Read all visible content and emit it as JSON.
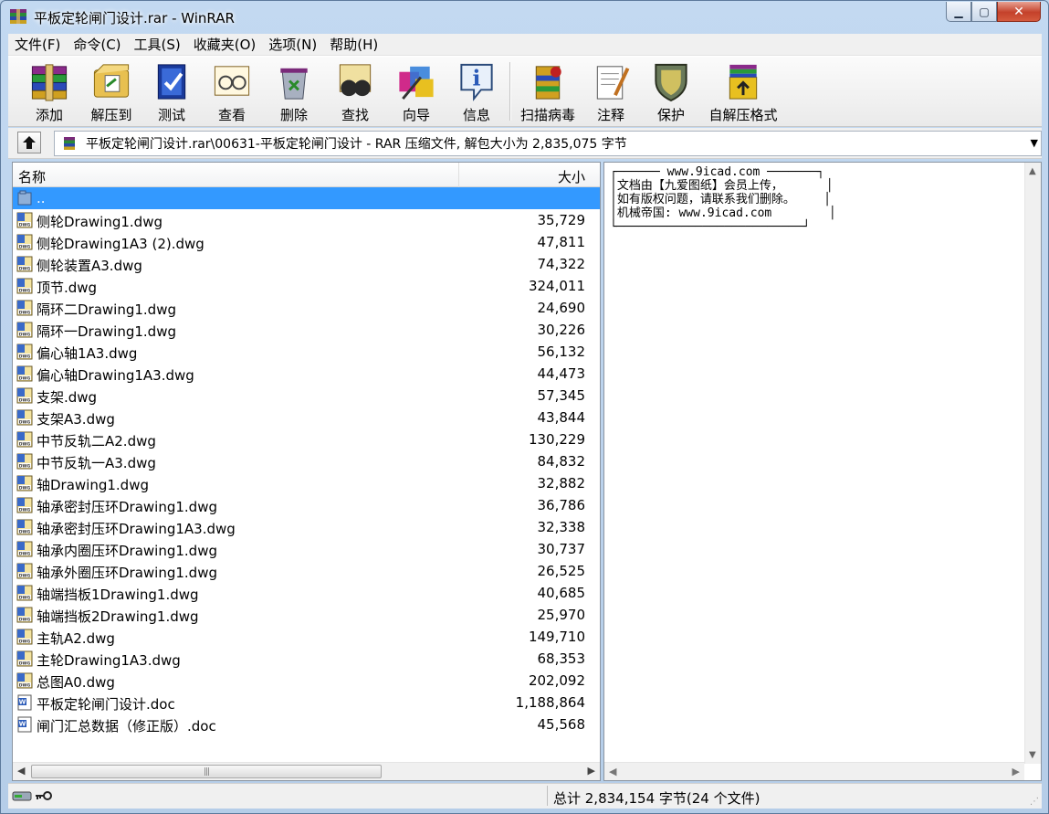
{
  "window": {
    "title": "平板定轮闸门设计.rar - WinRAR"
  },
  "menu": [
    "文件(F)",
    "命令(C)",
    "工具(S)",
    "收藏夹(O)",
    "选项(N)",
    "帮助(H)"
  ],
  "toolbar": [
    {
      "label": "添加",
      "icon": "add-archive-icon"
    },
    {
      "label": "解压到",
      "icon": "extract-to-icon"
    },
    {
      "label": "测试",
      "icon": "test-icon"
    },
    {
      "label": "查看",
      "icon": "view-icon"
    },
    {
      "label": "删除",
      "icon": "delete-icon"
    },
    {
      "label": "查找",
      "icon": "find-icon"
    },
    {
      "label": "向导",
      "icon": "wizard-icon"
    },
    {
      "label": "信息",
      "icon": "info-icon"
    },
    {
      "label": "扫描病毒",
      "icon": "scan-virus-icon"
    },
    {
      "label": "注释",
      "icon": "comment-icon"
    },
    {
      "label": "保护",
      "icon": "protect-icon"
    },
    {
      "label": "自解压格式",
      "icon": "sfx-icon"
    }
  ],
  "address": {
    "path": "平板定轮闸门设计.rar\\00631-平板定轮闸门设计 - RAR 压缩文件, 解包大小为 2,835,075 字节"
  },
  "list": {
    "col_name": "名称",
    "col_size": "大小",
    "rows": [
      {
        "name": "..",
        "size": "",
        "type": "folder-up",
        "selected": true
      },
      {
        "name": "侧轮Drawing1.dwg",
        "size": "35,729",
        "type": "dwg"
      },
      {
        "name": "侧轮Drawing1A3 (2).dwg",
        "size": "47,811",
        "type": "dwg"
      },
      {
        "name": "侧轮装置A3.dwg",
        "size": "74,322",
        "type": "dwg"
      },
      {
        "name": "顶节.dwg",
        "size": "324,011",
        "type": "dwg"
      },
      {
        "name": "隔环二Drawing1.dwg",
        "size": "24,690",
        "type": "dwg"
      },
      {
        "name": "隔环一Drawing1.dwg",
        "size": "30,226",
        "type": "dwg"
      },
      {
        "name": "偏心轴1A3.dwg",
        "size": "56,132",
        "type": "dwg"
      },
      {
        "name": "偏心轴Drawing1A3.dwg",
        "size": "44,473",
        "type": "dwg"
      },
      {
        "name": "支架.dwg",
        "size": "57,345",
        "type": "dwg"
      },
      {
        "name": "支架A3.dwg",
        "size": "43,844",
        "type": "dwg"
      },
      {
        "name": "中节反轨二A2.dwg",
        "size": "130,229",
        "type": "dwg"
      },
      {
        "name": "中节反轨一A3.dwg",
        "size": "84,832",
        "type": "dwg"
      },
      {
        "name": "轴Drawing1.dwg",
        "size": "32,882",
        "type": "dwg"
      },
      {
        "name": "轴承密封压环Drawing1.dwg",
        "size": "36,786",
        "type": "dwg"
      },
      {
        "name": "轴承密封压环Drawing1A3.dwg",
        "size": "32,338",
        "type": "dwg"
      },
      {
        "name": "轴承内圈压环Drawing1.dwg",
        "size": "30,737",
        "type": "dwg"
      },
      {
        "name": "轴承外圈压环Drawing1.dwg",
        "size": "26,525",
        "type": "dwg"
      },
      {
        "name": "轴端挡板1Drawing1.dwg",
        "size": "40,685",
        "type": "dwg"
      },
      {
        "name": "轴端挡板2Drawing1.dwg",
        "size": "25,970",
        "type": "dwg"
      },
      {
        "name": "主轨A2.dwg",
        "size": "149,710",
        "type": "dwg"
      },
      {
        "name": "主轮Drawing1A3.dwg",
        "size": "68,353",
        "type": "dwg"
      },
      {
        "name": "总图A0.dwg",
        "size": "202,092",
        "type": "dwg"
      },
      {
        "name": "平板定轮闸门设计.doc",
        "size": "1,188,864",
        "type": "doc"
      },
      {
        "name": "闸门汇总数据（修正版）.doc",
        "size": "45,568",
        "type": "doc"
      }
    ]
  },
  "comment": {
    "lines": [
      "┌────── www.9icad.com ───────┐",
      "│文档由【九爱图纸】会员上传，      │",
      "│如有版权问题，请联系我们删除。    │",
      "│机械帝国: www.9icad.com        │",
      "└──────────────────────────┘"
    ]
  },
  "status": {
    "total": "总计 2,834,154 字节(24 个文件)"
  },
  "colors": {
    "selection": "#3399ff",
    "close_button": "#c4412a"
  }
}
